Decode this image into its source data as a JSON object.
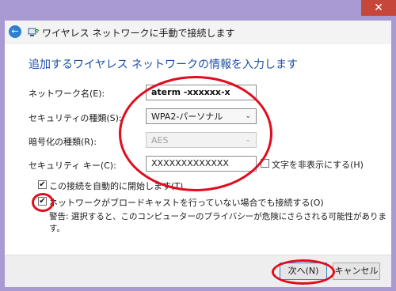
{
  "window": {
    "title": "ワイヤレス ネットワークに手動で接続します",
    "close_symbol": "✕"
  },
  "heading": "追加するワイヤレス ネットワークの情報を入力します",
  "form": {
    "network_name_label": "ネットワーク名(E):",
    "network_name_value": "aterm -xxxxxx-x",
    "security_type_label": "セキュリティの種類(S):",
    "security_type_value": "WPA2-パーソナル",
    "encryption_type_label": "暗号化の種類(R):",
    "encryption_type_value": "AES",
    "security_key_label": "セキュリティ キー(C):",
    "security_key_value": "XXXXXXXXXXXXX",
    "hide_chars_label": "文字を非表示にする(H)"
  },
  "options": {
    "auto_connect_label": "この接続を自動的に開始します(T)",
    "auto_connect_checked": true,
    "connect_hidden_label": "ネットワークがブロードキャストを行っていない場合でも接続する(O)",
    "connect_hidden_checked": true,
    "warning_text": "警告: 選択すると、このコンピューターのプライバシーが危険にさらされる可能性があります。"
  },
  "buttons": {
    "next": "次へ(N)",
    "cancel": "キャンセル"
  },
  "icons": {
    "back": "back-arrow-icon",
    "network": "wireless-network-icon",
    "dropdown": "chevron-down-icon",
    "check_mark": "✔",
    "chevron": "⌄",
    "back_arrow": "←"
  },
  "colors": {
    "accent_frame": "#a99ad4",
    "heading_blue": "#1d4fa8",
    "annotation_red": "#e10c1e"
  }
}
